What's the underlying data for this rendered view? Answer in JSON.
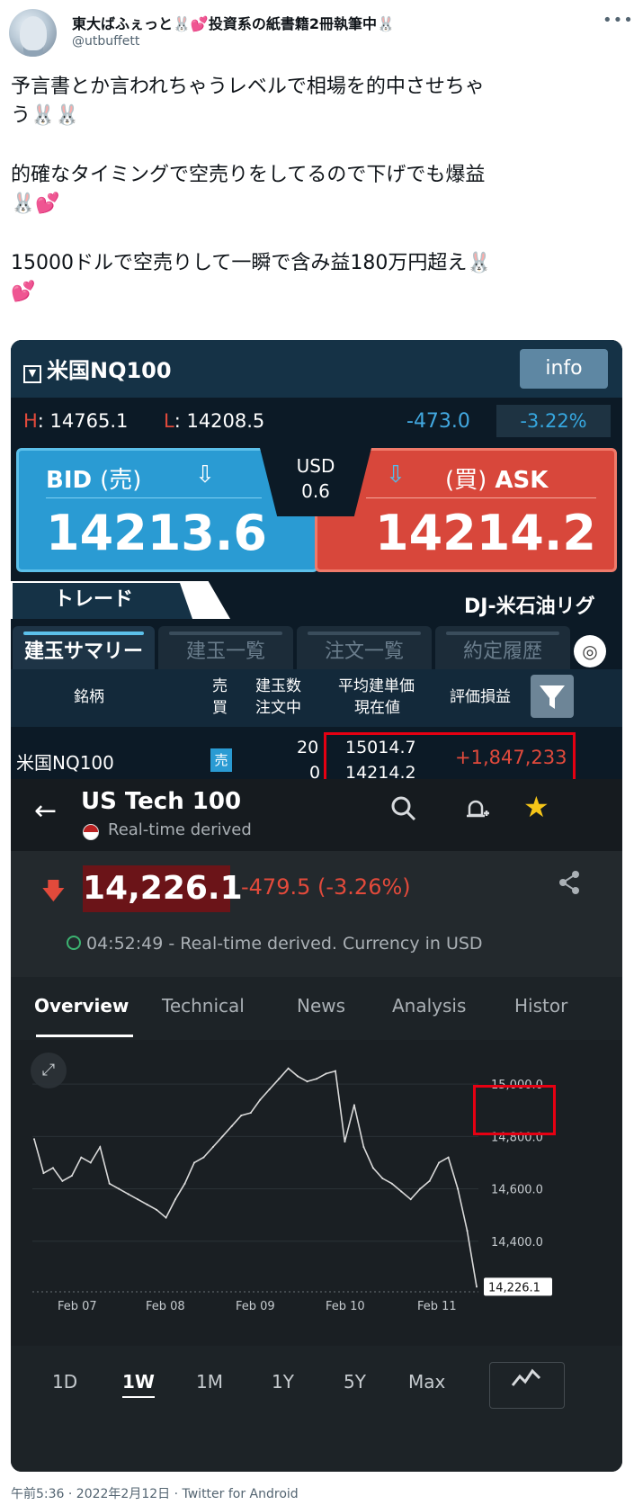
{
  "tweet": {
    "display_name": "東大ばふぇっと🐰💕投資系の紙書籍2冊執筆中🐰",
    "handle": "@utbuffett",
    "more_icon": "more-icon",
    "lines": [
      "予言書とか言われちゃうレベルで相場を的中させちゃ",
      "う🐰🐰",
      "的確なタイミングで空売りをしてるので下げでも爆益",
      "🐰💕",
      "15000ドルで空売りして一瞬で含み益180万円超え🐰",
      "💕"
    ],
    "footer": "午前5:36 · 2022年2月12日 · Twitter for Android"
  },
  "trading_app": {
    "symbol": "米国NQ100",
    "info_label": "info",
    "high_prefix": "H",
    "high_value": ": 14765.1",
    "low_prefix": "L",
    "low_value": ": 14208.5",
    "change": "-473.0",
    "change_pct": "-3.22%",
    "bid_label": "BID",
    "bid_sub": "(売)",
    "bid_price": "14213.6",
    "ask_label": "ASK",
    "ask_sub": "(買)",
    "ask_price": "14214.2",
    "spread_currency": "USD",
    "spread": "0.6",
    "tab_trade": "トレード",
    "tab_other": "DJ-米石油リグ",
    "subtabs": [
      "建玉サマリー",
      "建玉一覧",
      "注文一覧",
      "約定履歴"
    ],
    "headers": {
      "name": "銘柄",
      "side_1": "売",
      "side_2": "買",
      "qty_1": "建玉数",
      "qty_2": "注文中",
      "avg_1": "平均建単価",
      "avg_2": "現在値",
      "pnl": "評価損益"
    },
    "row": {
      "name": "米国NQ100",
      "side": "売",
      "qty": "20",
      "pending": "0",
      "avg_price": "15014.7",
      "current_price": "14214.2",
      "pnl": "+1,847,233"
    }
  },
  "investing_app": {
    "title": "US Tech 100",
    "subtitle": "Real-time derived",
    "price": "14,226.1",
    "change": "-479.5 (-3.26%)",
    "timestamp": "04:52:49 - Real-time derived. Currency in USD",
    "tabs": [
      "Overview",
      "Technical",
      "News",
      "Analysis",
      "Histor"
    ],
    "ranges": [
      "1D",
      "1W",
      "1M",
      "1Y",
      "5Y",
      "Max"
    ],
    "active_range": "1W",
    "current_tag": "14,226.1",
    "colors": {
      "down": "#e24a3b",
      "price_bg": "#6b1418",
      "bid": "#2a9bd3",
      "ask": "#d8473b"
    }
  },
  "chart_data": {
    "type": "line",
    "x_labels": [
      "Feb 07",
      "Feb 08",
      "Feb 09",
      "Feb 10",
      "Feb 11"
    ],
    "y_ticks": [
      "15,000.0",
      "14,800.0",
      "14,600.0",
      "14,400.0"
    ],
    "ylim": [
      14200,
      15100
    ],
    "series": [
      {
        "values": [
          14790,
          14660,
          14680,
          14630,
          14650,
          14720,
          14700,
          14760,
          14620,
          14600,
          14580,
          14560,
          14540,
          14520,
          14490,
          14560,
          14620,
          14700,
          14720,
          14760,
          14800,
          14840,
          14880,
          14890,
          14940,
          14980,
          15020,
          15060,
          15030,
          15010,
          15020,
          15040,
          15050,
          14780,
          14920,
          14760,
          14680,
          14640,
          14620,
          14590,
          14560,
          14600,
          14630,
          14700,
          14720,
          14600,
          14440,
          14226
        ]
      }
    ]
  }
}
